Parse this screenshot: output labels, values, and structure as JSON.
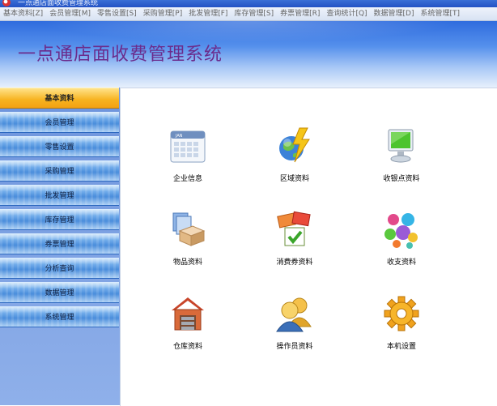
{
  "window": {
    "title": "一点通店面收费管理系统"
  },
  "menubar": {
    "items": [
      {
        "label": "基本资料[Z]"
      },
      {
        "label": "会员管理[M]"
      },
      {
        "label": "零售设置[S]"
      },
      {
        "label": "采购管理[P]"
      },
      {
        "label": "批发管理[F]"
      },
      {
        "label": "库存管理[S]"
      },
      {
        "label": "券票管理[R]"
      },
      {
        "label": "查询统计[Q]"
      },
      {
        "label": "数据管理[D]"
      },
      {
        "label": "系统管理[T]"
      }
    ]
  },
  "header": {
    "app_title": "一点通店面收费管理系统"
  },
  "sidebar": {
    "items": [
      {
        "label": "基本资料",
        "active": true
      },
      {
        "label": "会员管理"
      },
      {
        "label": "零售设置"
      },
      {
        "label": "采购管理"
      },
      {
        "label": "批发管理"
      },
      {
        "label": "库存管理"
      },
      {
        "label": "券票管理"
      },
      {
        "label": "分析查询"
      },
      {
        "label": "数据管理"
      },
      {
        "label": "系统管理"
      }
    ]
  },
  "content": {
    "tiles": [
      {
        "label": "企业信息",
        "icon": "calendar-icon"
      },
      {
        "label": "区域资料",
        "icon": "globe-lightning-icon"
      },
      {
        "label": "收银点资料",
        "icon": "monitor-icon"
      },
      {
        "label": "物品资料",
        "icon": "box-documents-icon"
      },
      {
        "label": "消费券资料",
        "icon": "coupon-check-icon"
      },
      {
        "label": "收支资料",
        "icon": "colored-balls-icon"
      },
      {
        "label": "仓库资料",
        "icon": "warehouse-icon"
      },
      {
        "label": "操作员资料",
        "icon": "users-icon"
      },
      {
        "label": "本机设置",
        "icon": "gear-icon"
      }
    ]
  },
  "colors": {
    "banner_top": "#2f6cde",
    "title_purple": "#6b2c8c",
    "nav_blue": "#4f95e3",
    "nav_active": "#f7b21e"
  }
}
